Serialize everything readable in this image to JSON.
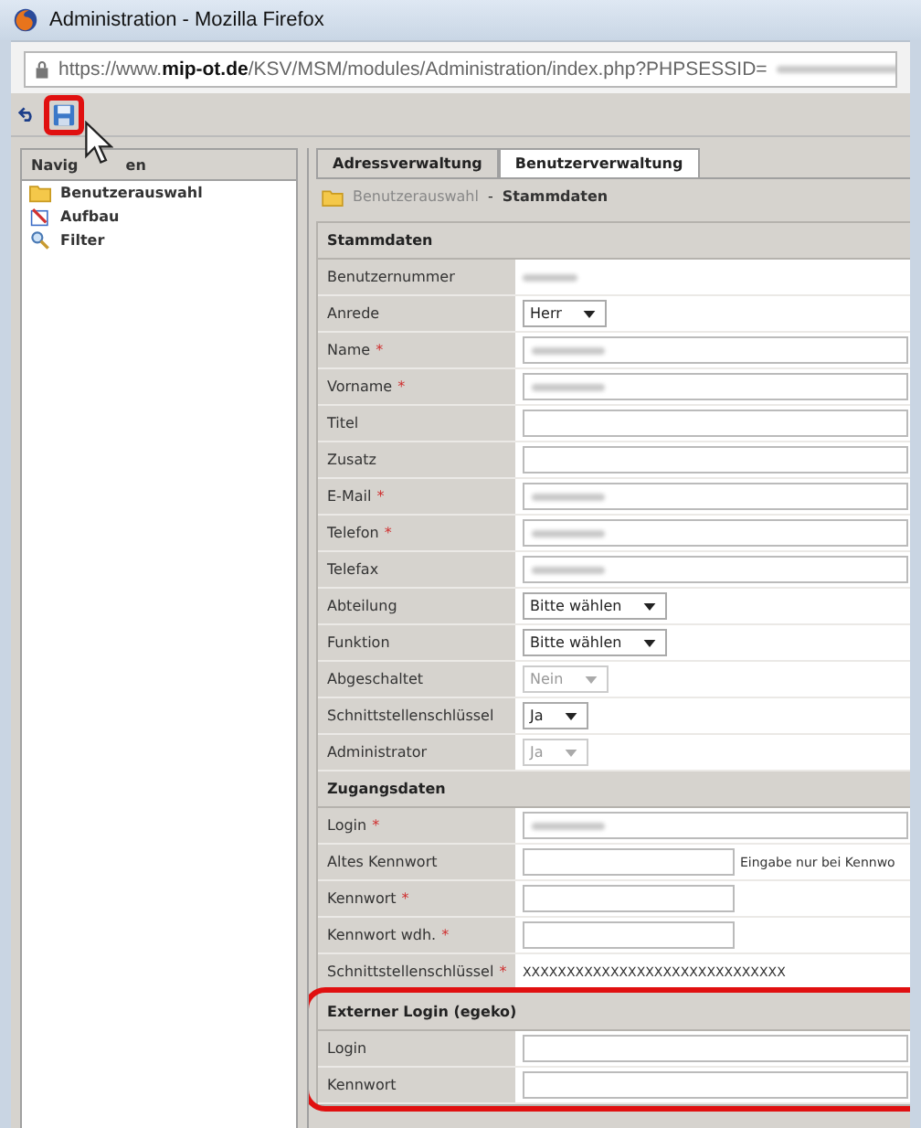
{
  "window": {
    "title": "Administration - Mozilla Firefox"
  },
  "address_bar": {
    "prefix": "https://www.",
    "domain": "mip-ot.de",
    "path": "/KSV/MSM/modules/Administration/index.php?PHPSESSID=",
    "redacted": true
  },
  "toolbar": {
    "save_highlighted": true
  },
  "navigation": {
    "title_start": "Navig",
    "title_end": "en",
    "items": [
      {
        "label": "Benutzerauswahl",
        "kind": "folder"
      },
      {
        "label": "Aufbau",
        "kind": "layout"
      },
      {
        "label": "Filter",
        "kind": "search"
      }
    ]
  },
  "tabs": [
    {
      "label": "Adressverwaltung",
      "selected": false
    },
    {
      "label": "Benutzerverwaltung",
      "selected": true
    }
  ],
  "breadcrumb": {
    "parent": "Benutzerauswahl",
    "separator": "-",
    "current": "Stammdaten"
  },
  "sections": [
    {
      "title": "Stammdaten",
      "highlighted": false,
      "rows": [
        {
          "kind": "static",
          "label": "Benutzernummer",
          "redacted": true
        },
        {
          "kind": "select",
          "label": "Anrede",
          "value": "Herr",
          "disabled": false
        },
        {
          "kind": "input",
          "label": "Name",
          "required_mark": "*",
          "redacted": true
        },
        {
          "kind": "input",
          "label": "Vorname",
          "required_mark": "*",
          "redacted": true
        },
        {
          "kind": "input",
          "label": "Titel",
          "redacted": false
        },
        {
          "kind": "input",
          "label": "Zusatz",
          "redacted": false
        },
        {
          "kind": "input",
          "label": "E-Mail",
          "required_mark": "*",
          "redacted": true
        },
        {
          "kind": "input",
          "label": "Telefon",
          "required_mark": "*",
          "redacted": true
        },
        {
          "kind": "input",
          "label": "Telefax",
          "redacted": true
        },
        {
          "kind": "select",
          "label": "Abteilung",
          "value": "Bitte wählen",
          "disabled": false
        },
        {
          "kind": "select",
          "label": "Funktion",
          "value": "Bitte wählen",
          "disabled": false
        },
        {
          "kind": "select",
          "label": "Abgeschaltet",
          "value": "Nein",
          "disabled": true
        },
        {
          "kind": "select",
          "label": "Schnittstellenschlüssel",
          "value": "Ja",
          "disabled": false
        },
        {
          "kind": "select",
          "label": "Administrator",
          "value": "Ja",
          "disabled": true
        }
      ]
    },
    {
      "title": "Zugangsdaten",
      "highlighted": false,
      "rows": [
        {
          "kind": "input",
          "label": "Login",
          "required_mark": "*",
          "redacted": true
        },
        {
          "kind": "short-input",
          "label": "Altes Kennwort",
          "redacted": false,
          "note": "Eingabe nur bei Kennwo"
        },
        {
          "kind": "short-input",
          "label": "Kennwort",
          "required_mark": "*",
          "redacted": false
        },
        {
          "kind": "short-input",
          "label": "Kennwort wdh.",
          "required_mark": "*",
          "redacted": false
        },
        {
          "kind": "static",
          "label": "Schnittstellenschlüssel",
          "required_mark": "*",
          "redacted": false,
          "value": "XXXXXXXXXXXXXXXXXXXXXXXXXXXXXX"
        }
      ]
    },
    {
      "title": "Externer Login (egeko)",
      "highlighted": true,
      "rows": [
        {
          "kind": "input",
          "label": "Login",
          "redacted": false
        },
        {
          "kind": "input",
          "label": "Kennwort",
          "redacted": false
        }
      ]
    }
  ]
}
